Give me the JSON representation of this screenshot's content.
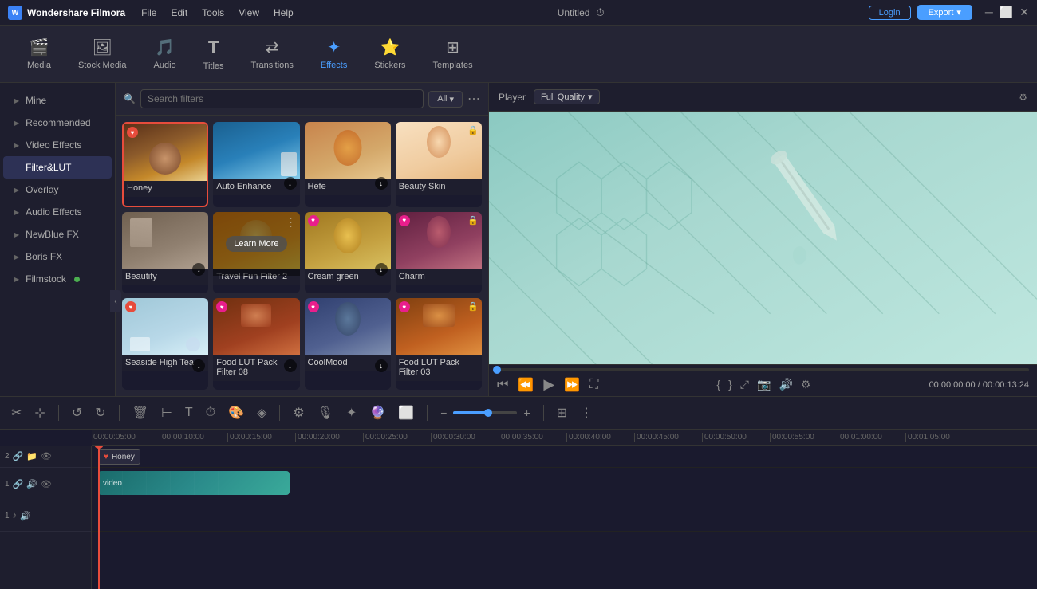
{
  "app": {
    "name": "Wondershare Filmora",
    "title": "Untitled",
    "logo_icon": "W"
  },
  "topbar": {
    "menu": [
      "File",
      "Edit",
      "Tools",
      "View",
      "Help"
    ],
    "login_label": "Login",
    "export_label": "Export"
  },
  "toolbar": {
    "items": [
      {
        "id": "media",
        "icon": "🎬",
        "label": "Media"
      },
      {
        "id": "stock-media",
        "icon": "📷",
        "label": "Stock Media"
      },
      {
        "id": "audio",
        "icon": "🎵",
        "label": "Audio"
      },
      {
        "id": "titles",
        "icon": "T",
        "label": "Titles"
      },
      {
        "id": "transitions",
        "icon": "⇄",
        "label": "Transitions"
      },
      {
        "id": "effects",
        "icon": "✦",
        "label": "Effects"
      },
      {
        "id": "stickers",
        "icon": "⭐",
        "label": "Stickers"
      },
      {
        "id": "templates",
        "icon": "⊞",
        "label": "Templates"
      }
    ]
  },
  "sidebar": {
    "items": [
      {
        "id": "mine",
        "label": "Mine",
        "arrow": "▶"
      },
      {
        "id": "recommended",
        "label": "Recommended",
        "arrow": "▶"
      },
      {
        "id": "video-effects",
        "label": "Video Effects",
        "arrow": "▶"
      },
      {
        "id": "filter-lut",
        "label": "Filter&LUT",
        "arrow": ""
      },
      {
        "id": "overlay",
        "label": "Overlay",
        "arrow": "▶"
      },
      {
        "id": "audio-effects",
        "label": "Audio Effects",
        "arrow": "▶"
      },
      {
        "id": "newblue-fx",
        "label": "NewBlue FX",
        "arrow": "▶"
      },
      {
        "id": "boris-fx",
        "label": "Boris FX",
        "arrow": "▶"
      },
      {
        "id": "filmstock",
        "label": "Filmstock",
        "arrow": "▶",
        "dot": true
      }
    ]
  },
  "filter_panel": {
    "search_placeholder": "Search filters",
    "all_label": "All",
    "filters": [
      {
        "id": "honey",
        "label": "Honey",
        "img_class": "img-honey",
        "selected": true,
        "badge": "♥",
        "badge_type": "red"
      },
      {
        "id": "auto-enhance",
        "label": "Auto Enhance",
        "img_class": "img-autoenhance",
        "dl": true
      },
      {
        "id": "hefe",
        "label": "Hefe",
        "img_class": "img-hefe",
        "dl": true
      },
      {
        "id": "beauty-skin",
        "label": "Beauty Skin",
        "img_class": "img-beautyskin",
        "lock": true
      },
      {
        "id": "beautify",
        "label": "Beautify",
        "img_class": "img-beautify",
        "dl": true
      },
      {
        "id": "travel-fun-2",
        "label": "Travel Fun Filter 2",
        "img_class": "img-travelfun",
        "has_overlay": true,
        "menu": true
      },
      {
        "id": "cream-green",
        "label": "Cream green",
        "img_class": "img-creamgreen",
        "badge": "♥",
        "badge_type": "pink",
        "dl": true
      },
      {
        "id": "charm",
        "label": "Charm",
        "img_class": "img-charm",
        "badge": "♥",
        "badge_type": "pink",
        "lock": true
      },
      {
        "id": "seaside-high-tea",
        "label": "Seaside High Tea",
        "img_class": "img-seaside",
        "badge": "♥",
        "badge_type": "red",
        "dl": true
      },
      {
        "id": "food-lut-08",
        "label": "Food LUT Pack Filter 08",
        "img_class": "img-foodlut08",
        "badge": "♥",
        "badge_type": "pink",
        "dl": true
      },
      {
        "id": "coolmood",
        "label": "CoolMood",
        "img_class": "img-coolmood",
        "badge": "♥",
        "badge_type": "pink",
        "dl": true
      },
      {
        "id": "food-lut-03",
        "label": "Food LUT Pack Filter 03",
        "img_class": "img-foodlut03",
        "badge": "♥",
        "badge_type": "pink",
        "lock": true
      }
    ]
  },
  "preview": {
    "player_label": "Player",
    "quality_label": "Full Quality",
    "current_time": "00:00:00:00",
    "total_time": "00:00:13:24"
  },
  "timeline": {
    "ruler_marks": [
      "00:00:05:00",
      "00:00:10:00",
      "00:00:15:00",
      "00:00:20:00",
      "00:00:25:00",
      "00:00:30:00",
      "00:00:35:00",
      "00:00:40:00",
      "00:00:45:00",
      "00:00:50:00",
      "00:00:55:00",
      "00:01:00:00",
      "00:01:05:00"
    ],
    "tracks": [
      {
        "id": "track-2",
        "num": "2",
        "type": "effect"
      },
      {
        "id": "track-1",
        "num": "1",
        "type": "video"
      },
      {
        "id": "audio-1",
        "num": "1",
        "type": "audio"
      }
    ],
    "honey_chip_label": "Honey",
    "video_clip_label": "video"
  }
}
